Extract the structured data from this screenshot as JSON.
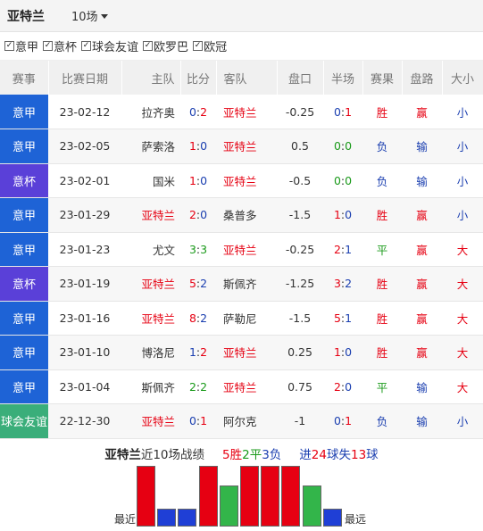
{
  "header": {
    "team": "亚特兰",
    "count_select": "10场"
  },
  "filters": [
    {
      "label": "意甲",
      "checked": true
    },
    {
      "label": "意杯",
      "checked": true
    },
    {
      "label": "球会友谊",
      "checked": true
    },
    {
      "label": "欧罗巴",
      "checked": true
    },
    {
      "label": "欧冠",
      "checked": true
    }
  ],
  "columns": [
    "赛事",
    "比赛日期",
    "主队",
    "比分",
    "客队",
    "盘口",
    "半场",
    "赛果",
    "盘路",
    "大小"
  ],
  "colors": {
    "comp_serie_a": "#1e63d6",
    "comp_cup": "#5a40d8",
    "comp_friendly": "#3aae7a",
    "win": "#e60012",
    "draw": "#1a9a1a",
    "lose": "#1b3fb0"
  },
  "matches": [
    {
      "comp": "意甲",
      "date": "23-02-12",
      "home": "拉齐奥",
      "hg": "0",
      "ag": "2",
      "away": "亚特兰",
      "handicap": "-0.25",
      "hh": "0",
      "ha": "1",
      "result": "胜",
      "cover": "赢",
      "ou": "小"
    },
    {
      "comp": "意甲",
      "date": "23-02-05",
      "home": "萨索洛",
      "hg": "1",
      "ag": "0",
      "away": "亚特兰",
      "handicap": "0.5",
      "hh": "0",
      "ha": "0",
      "result": "负",
      "cover": "输",
      "ou": "小"
    },
    {
      "comp": "意杯",
      "date": "23-02-01",
      "home": "国米",
      "hg": "1",
      "ag": "0",
      "away": "亚特兰",
      "handicap": "-0.5",
      "hh": "0",
      "ha": "0",
      "result": "负",
      "cover": "输",
      "ou": "小"
    },
    {
      "comp": "意甲",
      "date": "23-01-29",
      "home": "亚特兰",
      "hg": "2",
      "ag": "0",
      "away": "桑普多",
      "handicap": "-1.5",
      "hh": "1",
      "ha": "0",
      "result": "胜",
      "cover": "赢",
      "ou": "小"
    },
    {
      "comp": "意甲",
      "date": "23-01-23",
      "home": "尤文",
      "hg": "3",
      "ag": "3",
      "away": "亚特兰",
      "handicap": "-0.25",
      "hh": "2",
      "ha": "1",
      "result": "平",
      "cover": "赢",
      "ou": "大"
    },
    {
      "comp": "意杯",
      "date": "23-01-19",
      "home": "亚特兰",
      "hg": "5",
      "ag": "2",
      "away": "斯佩齐",
      "handicap": "-1.25",
      "hh": "3",
      "ha": "2",
      "result": "胜",
      "cover": "赢",
      "ou": "大"
    },
    {
      "comp": "意甲",
      "date": "23-01-16",
      "home": "亚特兰",
      "hg": "8",
      "ag": "2",
      "away": "萨勒尼",
      "handicap": "-1.5",
      "hh": "5",
      "ha": "1",
      "result": "胜",
      "cover": "赢",
      "ou": "大"
    },
    {
      "comp": "意甲",
      "date": "23-01-10",
      "home": "博洛尼",
      "hg": "1",
      "ag": "2",
      "away": "亚特兰",
      "handicap": "0.25",
      "hh": "1",
      "ha": "0",
      "result": "胜",
      "cover": "赢",
      "ou": "大"
    },
    {
      "comp": "意甲",
      "date": "23-01-04",
      "home": "斯佩齐",
      "hg": "2",
      "ag": "2",
      "away": "亚特兰",
      "handicap": "0.75",
      "hh": "2",
      "ha": "0",
      "result": "平",
      "cover": "输",
      "ou": "大"
    },
    {
      "comp": "球会友谊",
      "date": "22-12-30",
      "home": "亚特兰",
      "hg": "0",
      "ag": "1",
      "away": "阿尔克",
      "handicap": "-1",
      "hh": "0",
      "ha": "1",
      "result": "负",
      "cover": "输",
      "ou": "小"
    }
  ],
  "summary": {
    "team": "亚特兰",
    "text": "近10场战绩",
    "wins": "5胜",
    "draws": "2平",
    "losses": "3负",
    "goals_for_prefix": "进",
    "goals_for": "24",
    "goals_for_suffix": "球失",
    "goals_against": "13",
    "goals_against_suffix": "球"
  },
  "form_chart": {
    "label_left": "最近",
    "label_right": "最远",
    "results": [
      "胜",
      "负",
      "负",
      "胜",
      "平",
      "胜",
      "胜",
      "胜",
      "平",
      "负"
    ]
  }
}
